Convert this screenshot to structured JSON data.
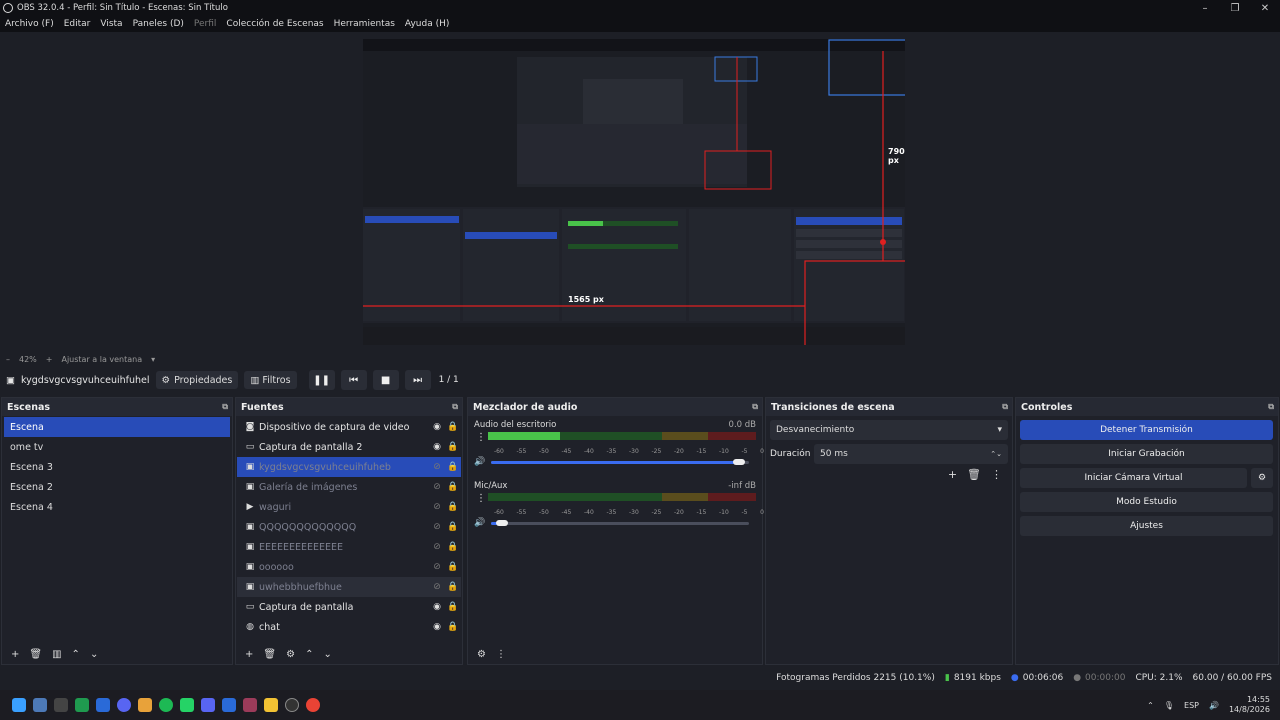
{
  "window": {
    "title": "OBS 32.0.4 - Perfil: Sin Título - Escenas: Sin Título",
    "controls": [
      "–",
      "❐",
      "✕"
    ]
  },
  "menu": [
    "Archivo (F)",
    "Editar",
    "Vista",
    "Paneles (D)",
    "Perfil",
    "Colección de Escenas",
    "Herramientas",
    "Ayuda (H)"
  ],
  "preview_labels": {
    "height": "790 px",
    "width": "1565 px"
  },
  "zoom": {
    "value": "42%",
    "fit_label": "Ajustar a la ventana"
  },
  "source_toolbar": {
    "selected_source": "kygdsvgcvsgvuhceuihfuhel",
    "properties": "Propiedades",
    "filters": "Filtros",
    "counter": "1 / 1"
  },
  "scenes": {
    "title": "Escenas",
    "items": [
      "Escena",
      "ome tv",
      "Escena 3",
      "Escena 2",
      "Escena 4"
    ]
  },
  "sources": {
    "title": "Fuentes",
    "items": [
      {
        "name": "Dispositivo de captura de video",
        "icon": "camera-icon",
        "visible": true
      },
      {
        "name": "Captura de pantalla 2",
        "icon": "monitor-icon",
        "visible": true
      },
      {
        "name": "kygdsvgcvsgvuhceuihfuheb",
        "icon": "media-icon",
        "visible": false
      },
      {
        "name": "Galería de imágenes",
        "icon": "media-icon",
        "visible": false
      },
      {
        "name": "waguri",
        "icon": "play-icon",
        "visible": false
      },
      {
        "name": "QQQQQQQQQQQQQ",
        "icon": "media-icon",
        "visible": false
      },
      {
        "name": "EEEEEEEEEEEEEE",
        "icon": "media-icon",
        "visible": false
      },
      {
        "name": "oooooo",
        "icon": "media-icon",
        "visible": false
      },
      {
        "name": "uwhebbhuefbhue",
        "icon": "media-icon",
        "visible": false
      },
      {
        "name": "Captura de pantalla",
        "icon": "monitor-icon",
        "visible": true
      },
      {
        "name": "chat",
        "icon": "globe-icon",
        "visible": true
      }
    ]
  },
  "mixer": {
    "title": "Mezclador de audio",
    "channels": [
      {
        "name": "Audio del escritorio",
        "db": "0.0 dB",
        "level": 0.27,
        "volume": 0.96
      },
      {
        "name": "Mic/Aux",
        "db": "-inf dB",
        "level": 0,
        "volume": 0.04
      }
    ],
    "scale": [
      "-60",
      "-55",
      "-50",
      "-45",
      "-40",
      "-35",
      "-30",
      "-25",
      "-20",
      "-15",
      "-10",
      "-5",
      "0"
    ]
  },
  "transitions": {
    "title": "Transiciones de escena",
    "selected": "Desvanecimiento",
    "duration_label": "Duración",
    "duration": "50 ms"
  },
  "controls": {
    "title": "Controles",
    "stop_stream": "Detener Transmisión",
    "start_recording": "Iniciar Grabación",
    "start_virtualcam": "Iniciar Cámara Virtual",
    "studio_mode": "Modo Estudio",
    "settings": "Ajustes"
  },
  "status": {
    "dropped_frames": "Fotogramas Perdidos 2215 (10.1%)",
    "bitrate": "8191 kbps",
    "stream_time": "00:06:06",
    "record_time": "00:00:00",
    "cpu": "CPU: 2.1%",
    "fps": "60.00 / 60.00 FPS"
  },
  "taskbar": {
    "lang": "ESP",
    "time": "14:55",
    "date": "14/8/2026"
  }
}
